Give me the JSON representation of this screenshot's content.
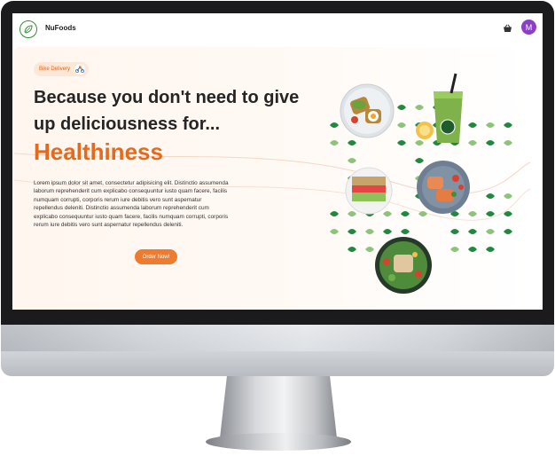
{
  "app": {
    "brand": "NuFoods",
    "avatar_initial": "M"
  },
  "hero": {
    "badge": "Bike Delivery",
    "headline": "Because you don't need to give up deliciousness for...",
    "highlight": "Healthiness",
    "description": "Lorem ipsum dolor sit amet, consectetur adipisicing elit. Distinctio assumenda laborum reprehenderit cum explicabo consequuntur iusto quam facere, facilis numquam corrupti, corporis rerum iure debitis vero sunt aspernatur repellendus deleniti. Distinctio assumenda laborum reprehenderit cum explicabo consequuntur iusto quam facere, facilis numquam corrupti, corporis rerum iure debitis vero sunt aspernatur repellendus deleniti.",
    "cta": "Order Now!"
  },
  "icons": {
    "logo": "leaf-logo-icon",
    "cart": "basket-icon",
    "bike": "bike-icon"
  },
  "colors": {
    "accent": "#e66a1d",
    "button": "#ef7b2e",
    "leaf_dark": "#1f8a3f",
    "leaf_light": "#8cc47a",
    "avatar": "#8b3fc8"
  }
}
